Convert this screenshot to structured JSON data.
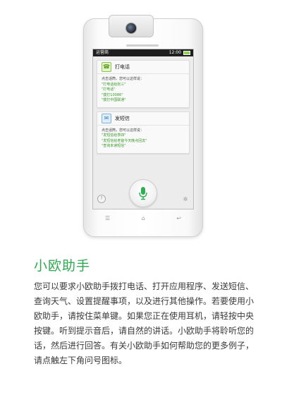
{
  "status_bar": {
    "carrier": "运营商",
    "time": "12:00"
  },
  "cards": [
    {
      "icon": "phone-call-icon",
      "title": "打电话",
      "intro": "点击话筒，您可以这样说：",
      "examples": [
        "\"打电话给张三\"",
        "\"打电话\"",
        "\"拨打10086\"",
        "\"拨打中国联通\""
      ]
    },
    {
      "icon": "sms-icon",
      "title": "发短信",
      "intro": "点击话筒，您可以这样说：",
      "examples": [
        "\"发短信给李四\"",
        "\"发短信给老爸今天晚点回去\"",
        "\"查询未读短信\""
      ]
    }
  ],
  "controls": {
    "help_label": "?",
    "settings_icon": "gear-icon",
    "mic_icon": "microphone-icon"
  },
  "title": "小欧助手",
  "description": "您可以要求小欧助手拨打电话、打开应用程序、发送短信、查询天气、设置提醒事项，以及进行其他操作。若要使用小欧助手，请按住菜单键。如果您正在使用耳机，请轻按中央按键。听到提示音后，请自然的讲话。小欧助手将聆听您的话，然后进行回答。有关小欧助手如何帮助您的更多例子，请点触左下角问号图标。",
  "colors": {
    "accent": "#2fa84f",
    "example_text": "#3a9a2a",
    "mic": "#2eae55"
  }
}
